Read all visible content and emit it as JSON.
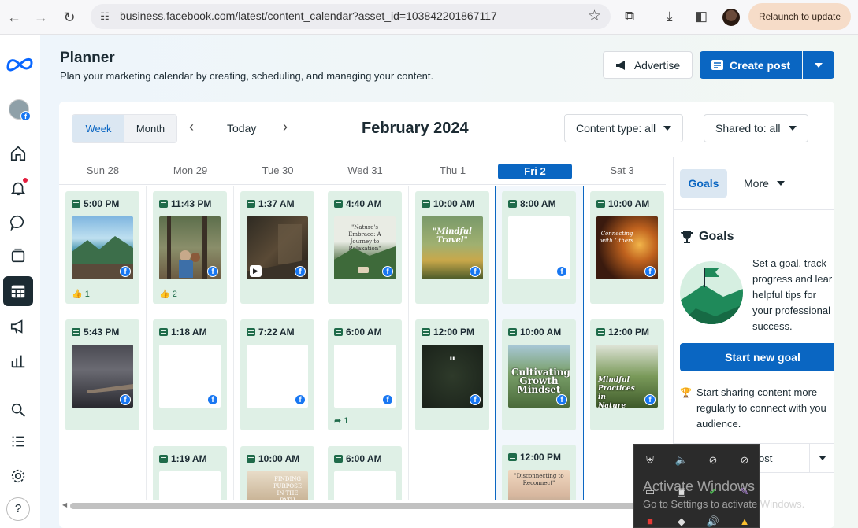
{
  "browser": {
    "url": "business.facebook.com/latest/content_calendar?asset_id=103842201867117",
    "relaunch_label": "Relaunch to update"
  },
  "header": {
    "title": "Planner",
    "subtitle": "Plan your marketing calendar by creating, scheduling, and managing your content.",
    "advertise_label": "Advertise",
    "create_post_label": "Create post"
  },
  "toolbar": {
    "week_label": "Week",
    "month_label": "Month",
    "today_label": "Today",
    "period": "February 2024",
    "content_type_label": "Content type: all",
    "shared_to_label": "Shared to: all"
  },
  "days": [
    {
      "label": "Sun 28"
    },
    {
      "label": "Mon 29"
    },
    {
      "label": "Tue 30"
    },
    {
      "label": "Wed 31"
    },
    {
      "label": "Thu 1"
    },
    {
      "label": "Fri 2"
    },
    {
      "label": "Sat 3"
    }
  ],
  "posts": [
    {
      "time": "5:00 PM",
      "meta": "1",
      "meta_icon": "like-icon"
    },
    {
      "time": "11:43 PM",
      "meta": "2",
      "meta_icon": "like-icon"
    },
    {
      "time": "1:37 AM"
    },
    {
      "time": "4:40 AM",
      "thumb_text": "\"Nature's Embrace: A Journey to Relaxation\""
    },
    {
      "time": "10:00 AM",
      "thumb_text": "\"Mindful Travel\""
    },
    {
      "time": "8:00 AM"
    },
    {
      "time": "10:00 AM",
      "thumb_text": "Connecting with Others"
    },
    {
      "time": "5:43 PM"
    },
    {
      "time": "1:18 AM"
    },
    {
      "time": "7:22 AM"
    },
    {
      "time": "6:00 AM",
      "meta": "1",
      "meta_icon": "share-icon"
    },
    {
      "time": "12:00 PM"
    },
    {
      "time": "10:00 AM",
      "thumb_text": "Cultivating Growth Mindset"
    },
    {
      "time": "12:00 PM",
      "thumb_text": "Mindful Practices in Nature"
    },
    {
      "time": "1:19 AM"
    },
    {
      "time": "10:00 AM",
      "thumb_text": "FINDING PURPOSE IN THE PATH"
    },
    {
      "time": "6:00 AM"
    },
    {
      "time": "12:00 PM",
      "thumb_text": "\"Disconnecting to Reconnect\""
    }
  ],
  "goals_panel": {
    "goals_tab": "Goals",
    "more_tab": "More",
    "heading": "Goals",
    "desc_lines": [
      "Set a goal, track",
      "progress and lear",
      "helpful tips for",
      "your professional",
      "success."
    ],
    "start_goal_label": "Start new goal",
    "tip_lines": [
      "Start sharing content more",
      "regularly to connect with you",
      "audience."
    ],
    "post_row_label": "ost"
  },
  "windows": {
    "activate_title": "Activate Windows",
    "activate_sub": "Go to Settings to activate Windows."
  },
  "colors": {
    "accent": "#0a66c2",
    "post_bg": "#dff0e6",
    "nav_active": "#1c2b33"
  }
}
